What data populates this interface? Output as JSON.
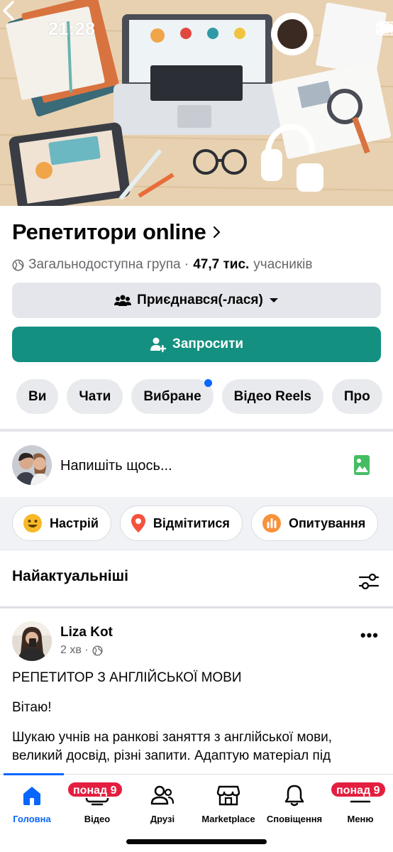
{
  "status_bar": {
    "time": "21:28"
  },
  "group": {
    "name": "Репетитори online",
    "privacy": "Загальнодоступна група ·",
    "members_count": "47,7 тис.",
    "members_label": "учасників",
    "joined_label": "Приєднався(-лася)",
    "invite_label": "Запросити"
  },
  "chips": [
    "Ви",
    "Чати",
    "Вибране",
    "Відео Reels",
    "Про"
  ],
  "composer": {
    "placeholder": "Напишіть щось..."
  },
  "actions": [
    "Настрій",
    "Відмітитися",
    "Опитування"
  ],
  "feed": {
    "section_title": "Найактуальніші"
  },
  "post": {
    "author": "Liza Kot",
    "time": "2 хв ·",
    "paragraphs": [
      "РЕПЕТИТОР З АНГЛІЙСЬКОЇ МОВИ",
      "Вітаю!",
      "Шукаю учнів на ранкові заняття з англійської мови, великий досвід, різні запити. Адаптую матеріал під"
    ]
  },
  "tabbar": {
    "tabs": [
      "Головна",
      "Відео",
      "Друзі",
      "Marketplace",
      "Сповіщення",
      "Меню"
    ],
    "badge_video": "понад 9",
    "badge_menu": "понад 9"
  },
  "colors": {
    "accent": "#0866ff",
    "invite_button": "#13907f",
    "badge": "#e41e3f"
  }
}
